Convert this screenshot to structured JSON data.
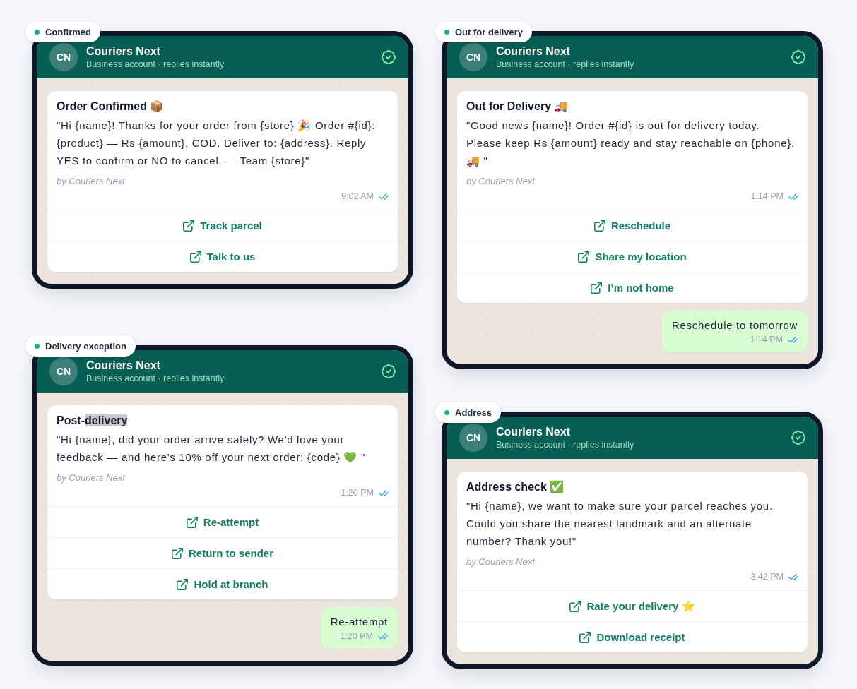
{
  "cards": [
    {
      "status": "Confirmed",
      "header": {
        "avatar": "CN",
        "name": "Couriers Next",
        "subtitle": "Business account · replies instantly"
      },
      "message": {
        "title": [
          {
            "text": "Order Confirmed 📦",
            "selected": false
          }
        ],
        "body": "\"Hi {name}! Thanks for your order from {store} 🎉 Order #{id}: {product} — Rs {amount}, COD. Deliver to: {address}. Reply YES to confirm or NO to cancel. — Team {store}\"",
        "byline": "by Couriers Next",
        "time": "9:02 AM",
        "buttons": [
          "Track parcel",
          "Talk to us"
        ]
      }
    },
    {
      "status": "Out for delivery",
      "header": {
        "avatar": "CN",
        "name": "Couriers Next",
        "subtitle": "Business account · replies instantly"
      },
      "message": {
        "title": [
          {
            "text": "Out for Delivery 🚚",
            "selected": false
          }
        ],
        "body": "\"Good news {name}! Order #{id} is out for delivery today. Please keep Rs {amount} ready and stay reachable on {phone}. 🚚 \"",
        "byline": "by Couriers Next",
        "time": "1:14 PM",
        "buttons": [
          "Reschedule",
          "Share my location",
          "I’m not home"
        ]
      },
      "reply": {
        "text": "Reschedule to tomorrow",
        "time": "1:14 PM"
      }
    },
    {
      "status": "Delivery exception",
      "header": {
        "avatar": "CN",
        "name": "Couriers Next",
        "subtitle": "Business account · replies instantly"
      },
      "message": {
        "title": [
          {
            "text": "Post-",
            "selected": false
          },
          {
            "text": "delivery",
            "selected": true
          }
        ],
        "body": "\"Hi {name}, did your order arrive safely? We'd love your feedback — and here's 10% off your next order: {code} 💚 \"",
        "byline": "by Couriers Next",
        "time": "1:20 PM",
        "buttons": [
          "Re-attempt",
          "Return to sender",
          "Hold at branch"
        ]
      },
      "reply": {
        "text": "Re-attempt",
        "time": "1:20 PM"
      }
    },
    {
      "status": "Address",
      "header": {
        "avatar": "CN",
        "name": "Couriers Next",
        "subtitle": "Business account · replies instantly"
      },
      "message": {
        "title": [
          {
            "text": "Address check ✅",
            "selected": false
          }
        ],
        "body": "\"Hi {name}, we want to make sure your parcel reaches you. Could you share the nearest landmark and an alternate number? Thank you!\"",
        "byline": "by Couriers Next",
        "time": "3:42 PM",
        "buttons": [
          "Rate your delivery ⭐",
          "Download receipt"
        ]
      }
    }
  ]
}
